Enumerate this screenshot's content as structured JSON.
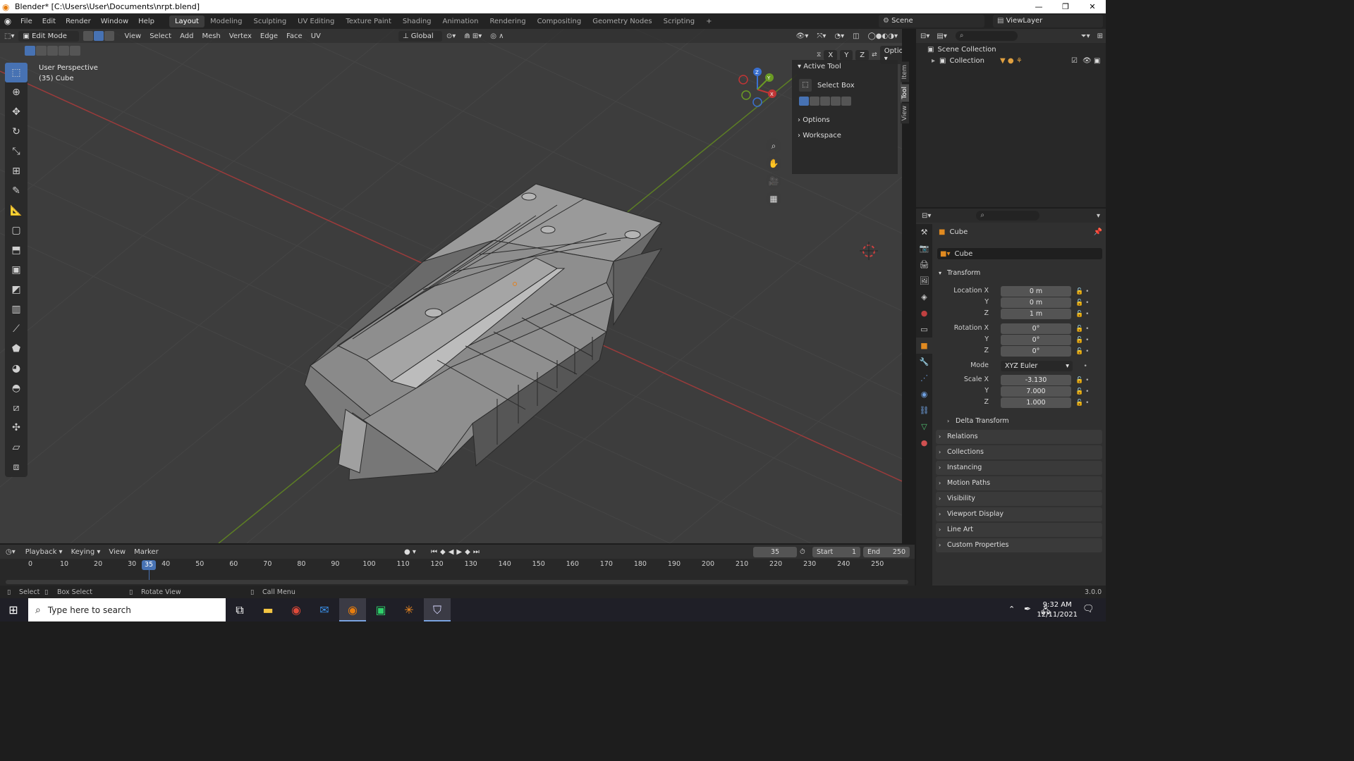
{
  "window": {
    "title": "Blender* [C:\\Users\\User\\Documents\\nrpt.blend]"
  },
  "menu": [
    "File",
    "Edit",
    "Render",
    "Window",
    "Help"
  ],
  "workspaces": [
    "Layout",
    "Modeling",
    "Sculpting",
    "UV Editing",
    "Texture Paint",
    "Shading",
    "Animation",
    "Rendering",
    "Compositing",
    "Geometry Nodes",
    "Scripting",
    "+"
  ],
  "scene": "Scene",
  "view_layer": "ViewLayer",
  "viewport": {
    "mode": "Edit Mode",
    "menus": [
      "View",
      "Select",
      "Add",
      "Mesh",
      "Vertex",
      "Edge",
      "Face",
      "UV"
    ],
    "transform_orientation": "Global",
    "options": "Options",
    "axis_locks": [
      "X",
      "Y",
      "Z"
    ],
    "info_line1": "User Perspective",
    "info_line2": "(35) Cube",
    "gizmo_axes": {
      "x": "X",
      "y": "Y",
      "z": "Z"
    }
  },
  "tool_panel": {
    "section": "Active Tool",
    "tool_name": "Select Box",
    "options": "Options",
    "workspace": "Workspace",
    "tabs": [
      "Item",
      "Tool",
      "View"
    ]
  },
  "outliner": {
    "scene_collection": "Scene Collection",
    "collection": "Collection"
  },
  "properties": {
    "object_name": "Cube",
    "datablock_name": "Cube",
    "transform_header": "Transform",
    "location_label": "Location X",
    "rotation_label": "Rotation X",
    "scale_label": "Scale X",
    "y_label": "Y",
    "z_label": "Z",
    "mode_label": "Mode",
    "location": [
      "0 m",
      "0 m",
      "1 m"
    ],
    "rotation": [
      "0°",
      "0°",
      "0°"
    ],
    "rotation_mode": "XYZ Euler",
    "scale": [
      "-3.130",
      "7.000",
      "1.000"
    ],
    "delta_transform": "Delta Transform",
    "panels": [
      "Relations",
      "Collections",
      "Instancing",
      "Motion Paths",
      "Visibility",
      "Viewport Display",
      "Line Art",
      "Custom Properties"
    ]
  },
  "timeline": {
    "menus": [
      "Playback",
      "Keying",
      "View",
      "Marker"
    ],
    "current_frame": "35",
    "start_label": "Start",
    "start": "1",
    "end_label": "End",
    "end": "250",
    "ticks": [
      "0",
      "10",
      "20",
      "30",
      "40",
      "50",
      "60",
      "70",
      "80",
      "90",
      "100",
      "110",
      "120",
      "130",
      "140",
      "150",
      "160",
      "170",
      "180",
      "190",
      "200",
      "210",
      "220",
      "230",
      "240",
      "250"
    ]
  },
  "statusbar": {
    "select": "Select",
    "box_select": "Box Select",
    "rotate_view": "Rotate View",
    "call_menu": "Call Menu",
    "version": "3.0.0"
  },
  "taskbar": {
    "search_placeholder": "Type here to search",
    "time": "9:32 AM",
    "date": "12/11/2021"
  },
  "colors": {
    "accent": "#4772b3",
    "viewport_bg": "#3d3d3d",
    "x_axis": "#c03535",
    "y_axis": "#6a9a24",
    "z_axis": "#3a70d0"
  }
}
